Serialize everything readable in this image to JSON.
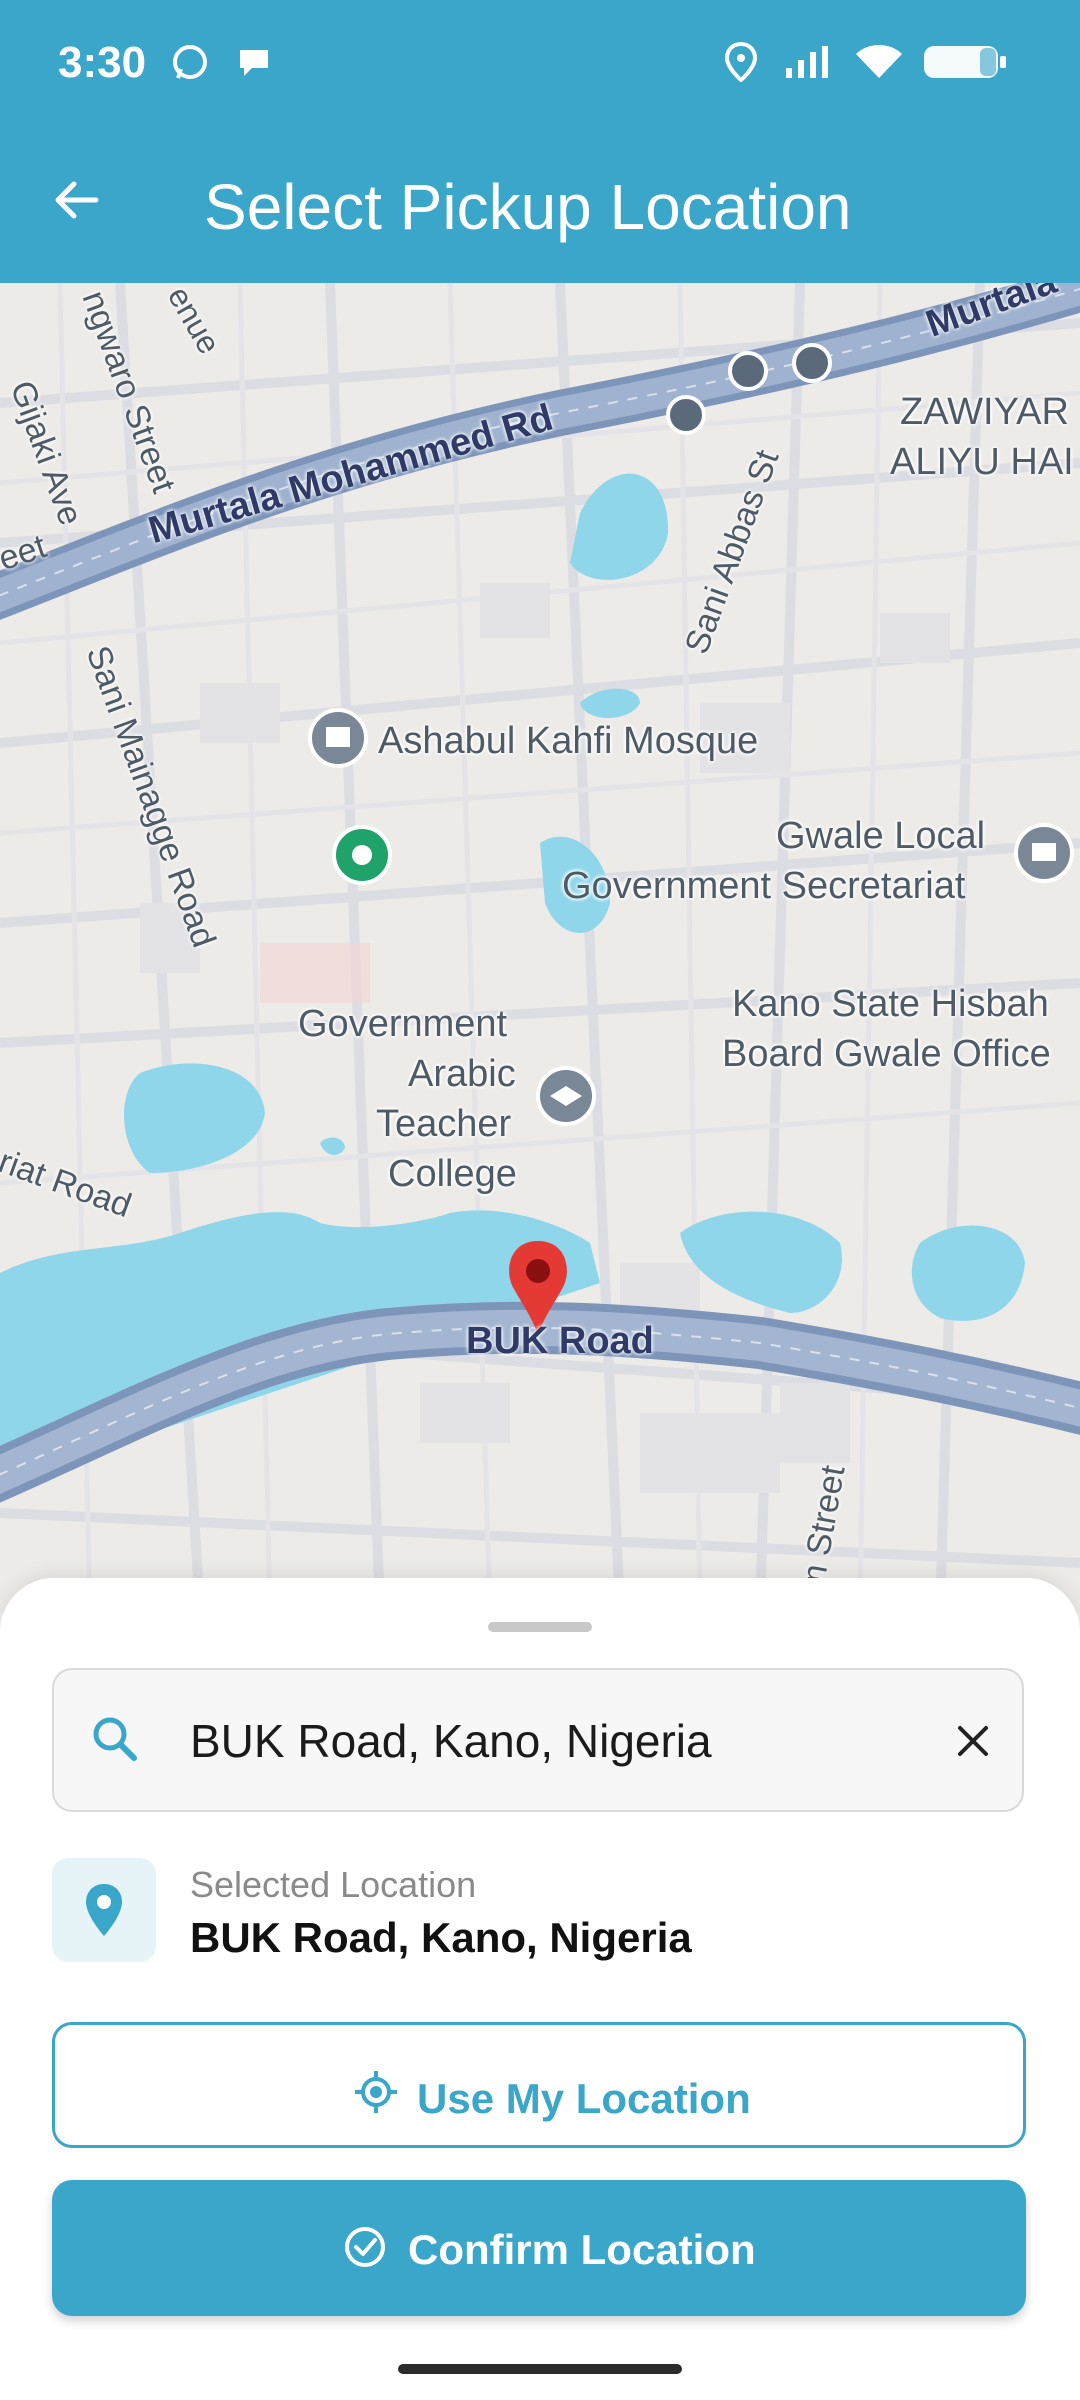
{
  "status": {
    "time": "3:30"
  },
  "appbar": {
    "title": "Select Pickup Location"
  },
  "map": {
    "roads": [
      "Murtala Mohammed Rd",
      "Murtala",
      "Sani Abbas St",
      "Gijaki Ave",
      "ngwaro Street",
      "enue",
      "eet",
      "Sani Mainagge Road",
      "riat Road",
      "BUK Road",
      "m Street"
    ],
    "places": [
      "Ashabul Kahfi Mosque",
      "Gwale Local",
      "Government Secretariat",
      "Kano State Hisbah",
      "Board Gwale Office",
      "Government",
      "Arabic",
      "Teacher",
      "College",
      "ZAWIYAR",
      "ALIYU HAI"
    ]
  },
  "search": {
    "value": "BUK Road, Kano, Nigeria"
  },
  "selected": {
    "caption": "Selected Location",
    "value": "BUK Road, Kano, Nigeria"
  },
  "buttons": {
    "use_location": "Use My Location",
    "confirm": "Confirm Location"
  },
  "colors": {
    "primary": "#3aa6c9",
    "water": "#8fd6ea",
    "road": "#8ea3c2",
    "marker": "#e53935"
  }
}
